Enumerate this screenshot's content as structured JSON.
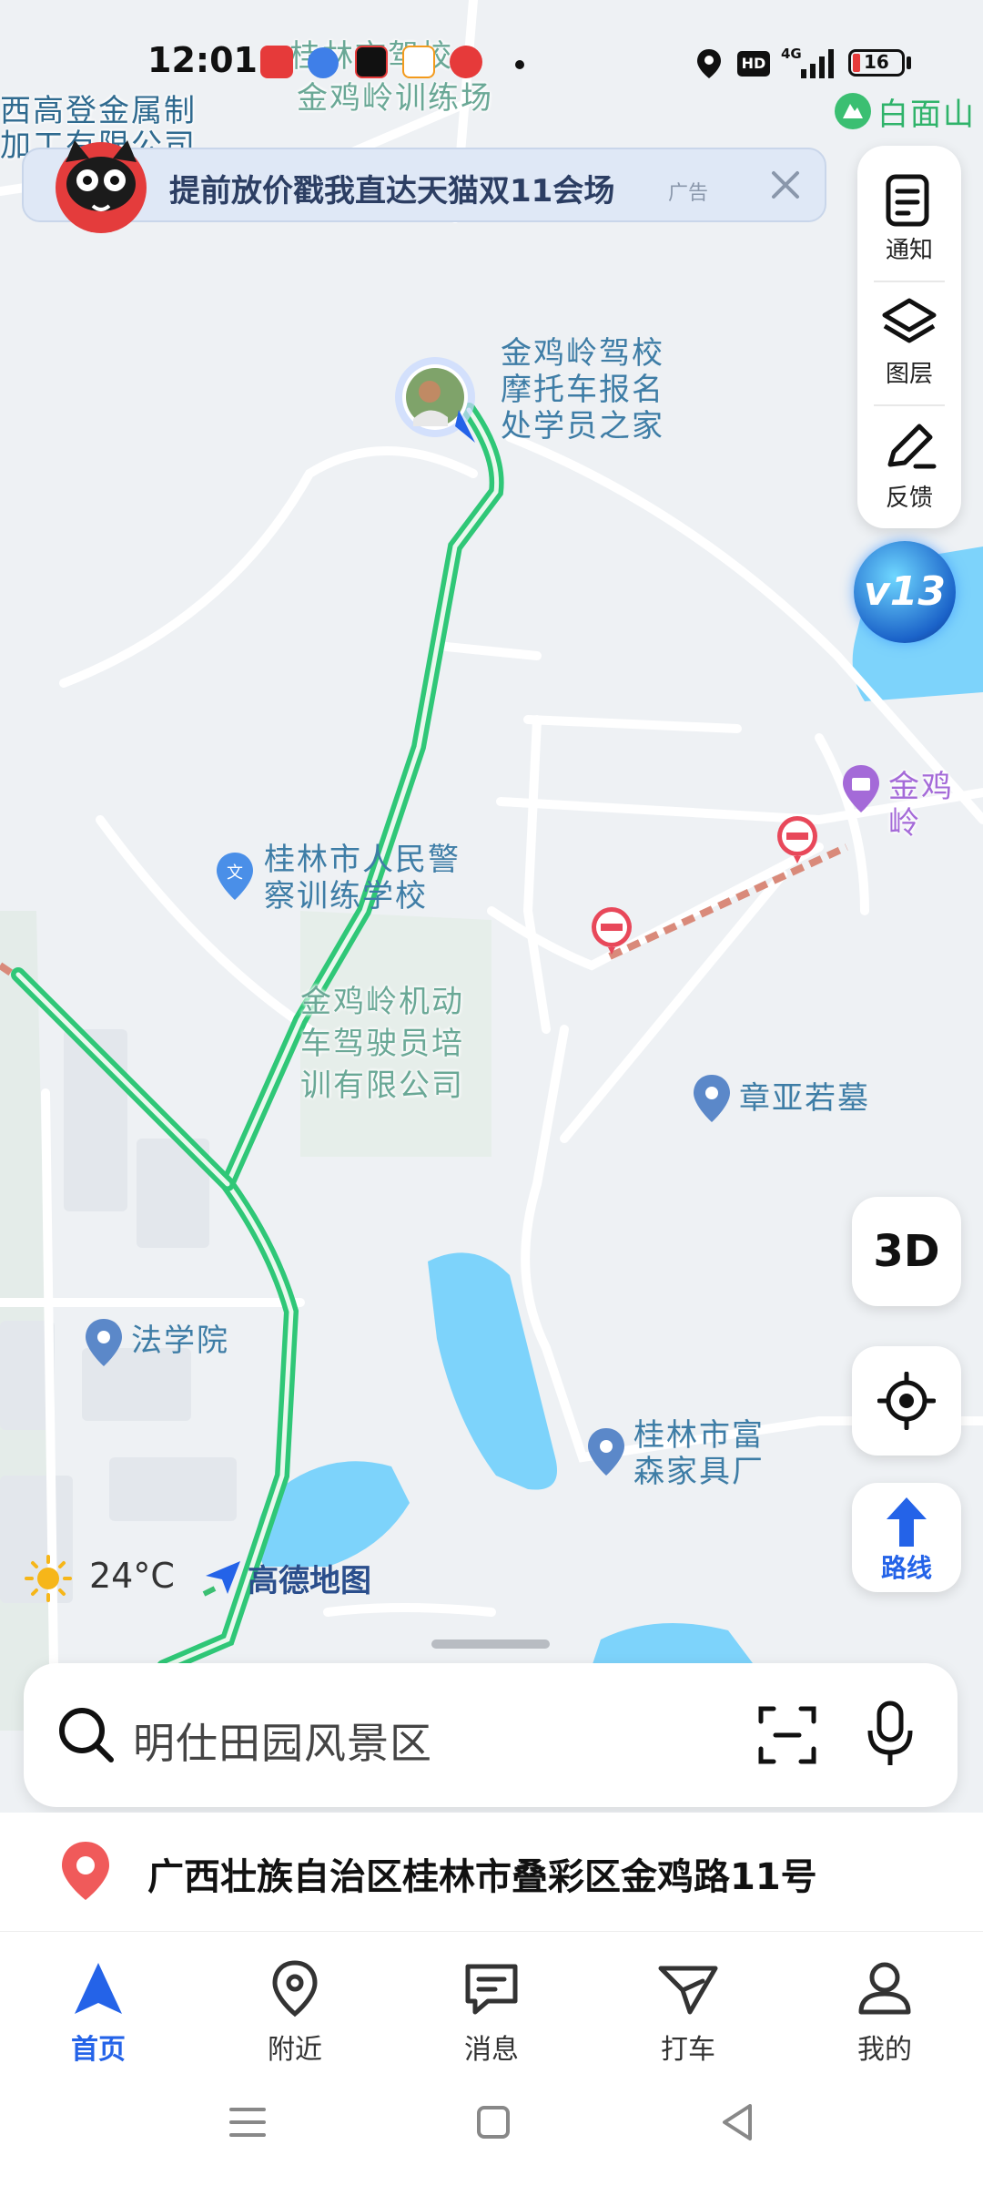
{
  "status_bar": {
    "time": "12:01",
    "battery": "16",
    "network": "4G",
    "hd": "HD"
  },
  "ad_banner": {
    "text": "提前放价戳我直达天猫双11会场",
    "tag": "广告"
  },
  "right_panel": {
    "notify": "通知",
    "layers": "图层",
    "feedback": "反馈"
  },
  "map_labels": {
    "school_top": "桂林市驾校",
    "training_field": "金鸡岭训练场",
    "factory": "西高登金属制",
    "factory2": "加工有限公司",
    "baimianshan": "白面山",
    "moto_school_1": "金鸡岭驾校",
    "moto_school_2": "摩托车报名",
    "moto_school_3": "处学员之家",
    "jinjiling": "金鸡岭",
    "police_school_1": "桂林市人民警",
    "police_school_2": "察训练学校",
    "driver_co_1": "金鸡岭机动",
    "driver_co_2": "车驾驶员培",
    "driver_co_3": "训有限公司",
    "tomb": "章亚若墓",
    "law_school": "法学院",
    "furniture_1": "桂林市富",
    "furniture_2": "森家具厂"
  },
  "version_badge": "v13",
  "buttons": {
    "three_d": "3D",
    "route": "路线"
  },
  "weather": {
    "temp": "24°C"
  },
  "brand": "高德地图",
  "search": {
    "placeholder": "明仕田园风景区"
  },
  "address": "广西壮族自治区桂林市叠彩区金鸡路11号",
  "tabs": [
    {
      "label": "首页",
      "icon": "home-arrow-icon",
      "active": true
    },
    {
      "label": "附近",
      "icon": "location-pin-icon"
    },
    {
      "label": "消息",
      "icon": "message-icon"
    },
    {
      "label": "打车",
      "icon": "taxi-icon"
    },
    {
      "label": "我的",
      "icon": "profile-icon"
    }
  ],
  "colors": {
    "accent": "#2463e8",
    "route_green": "#2fc777",
    "water": "#7dd3fb",
    "map_bg": "#eef1f4"
  }
}
